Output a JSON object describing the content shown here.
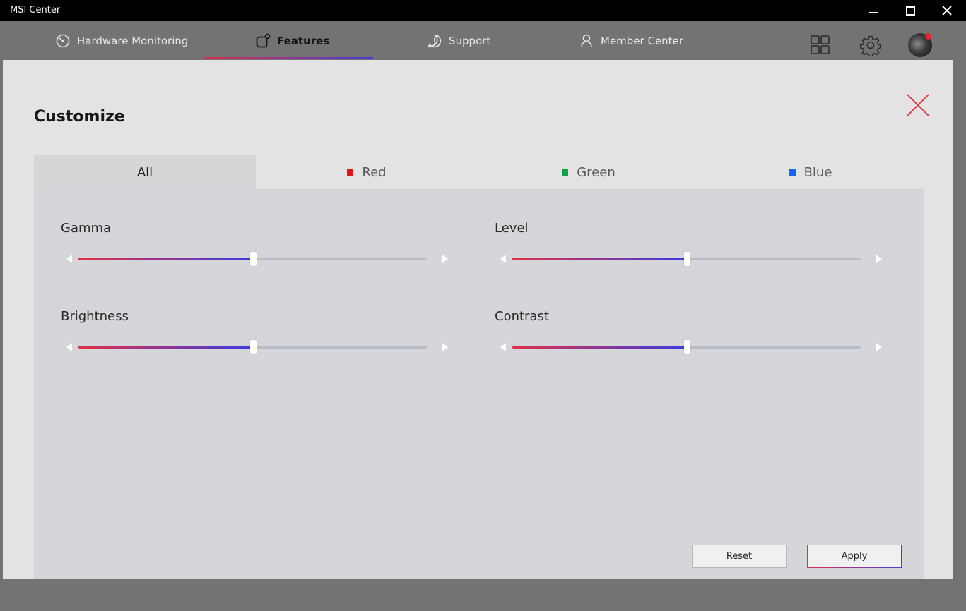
{
  "app": {
    "title": "MSI Center"
  },
  "nav": {
    "items": [
      {
        "label": "Hardware Monitoring",
        "icon": "gauge-icon"
      },
      {
        "label": "Features",
        "icon": "features-icon",
        "active": true
      },
      {
        "label": "Support",
        "icon": "chat-icon"
      },
      {
        "label": "Member Center",
        "icon": "person-icon"
      }
    ],
    "right_icons": [
      "grid-icon",
      "gear-icon",
      "avatar"
    ]
  },
  "dialog": {
    "title": "Customize",
    "tabs": [
      {
        "label": "All",
        "active": true
      },
      {
        "label": "Red",
        "swatch": "#e8101a"
      },
      {
        "label": "Green",
        "swatch": "#10a04a"
      },
      {
        "label": "Blue",
        "swatch": "#1566f0"
      }
    ],
    "controls": [
      {
        "label": "Gamma",
        "value": 0.5
      },
      {
        "label": "Level",
        "value": 0.5
      },
      {
        "label": "Brightness",
        "value": 0.5
      },
      {
        "label": "Contrast",
        "value": 0.5
      }
    ],
    "buttons": {
      "reset": "Reset",
      "apply": "Apply"
    }
  },
  "colors": {
    "accent_red": "#d8314a",
    "accent_blue": "#4a3ad6",
    "close_x": "#e0303e"
  }
}
